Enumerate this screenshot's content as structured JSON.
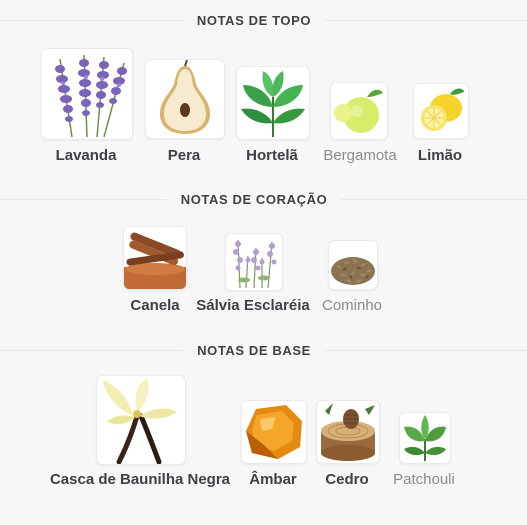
{
  "sections": {
    "top": {
      "title": "NOTAS DE TOPO",
      "notes": [
        {
          "name": "Lavanda",
          "icon": "lavender-icon",
          "emphasis": "strong"
        },
        {
          "name": "Pera",
          "icon": "pear-icon",
          "emphasis": "strong"
        },
        {
          "name": "Hortelã",
          "icon": "mint-icon",
          "emphasis": "strong"
        },
        {
          "name": "Bergamota",
          "icon": "bergamot-icon",
          "emphasis": "muted"
        },
        {
          "name": "Limão",
          "icon": "lemon-icon",
          "emphasis": "strong"
        }
      ]
    },
    "heart": {
      "title": "NOTAS DE CORAÇÃO",
      "notes": [
        {
          "name": "Canela",
          "icon": "cinnamon-icon",
          "emphasis": "strong"
        },
        {
          "name": "Sálvia Esclaréia",
          "icon": "clary-sage-icon",
          "emphasis": "strong"
        },
        {
          "name": "Cominho",
          "icon": "cumin-icon",
          "emphasis": "muted"
        }
      ]
    },
    "base": {
      "title": "NOTAS DE BASE",
      "notes": [
        {
          "name": "Casca de Baunilha Negra",
          "icon": "vanilla-icon",
          "emphasis": "strong"
        },
        {
          "name": "Âmbar",
          "icon": "amber-icon",
          "emphasis": "strong"
        },
        {
          "name": "Cedro",
          "icon": "cedar-icon",
          "emphasis": "strong"
        },
        {
          "name": "Patchouli",
          "icon": "patchouli-icon",
          "emphasis": "muted"
        }
      ]
    }
  },
  "colors": {
    "text": "#3f3f46",
    "muted_text": "#8a8a90",
    "background": "#f7f7f8",
    "divider": "#e6e6e8"
  }
}
